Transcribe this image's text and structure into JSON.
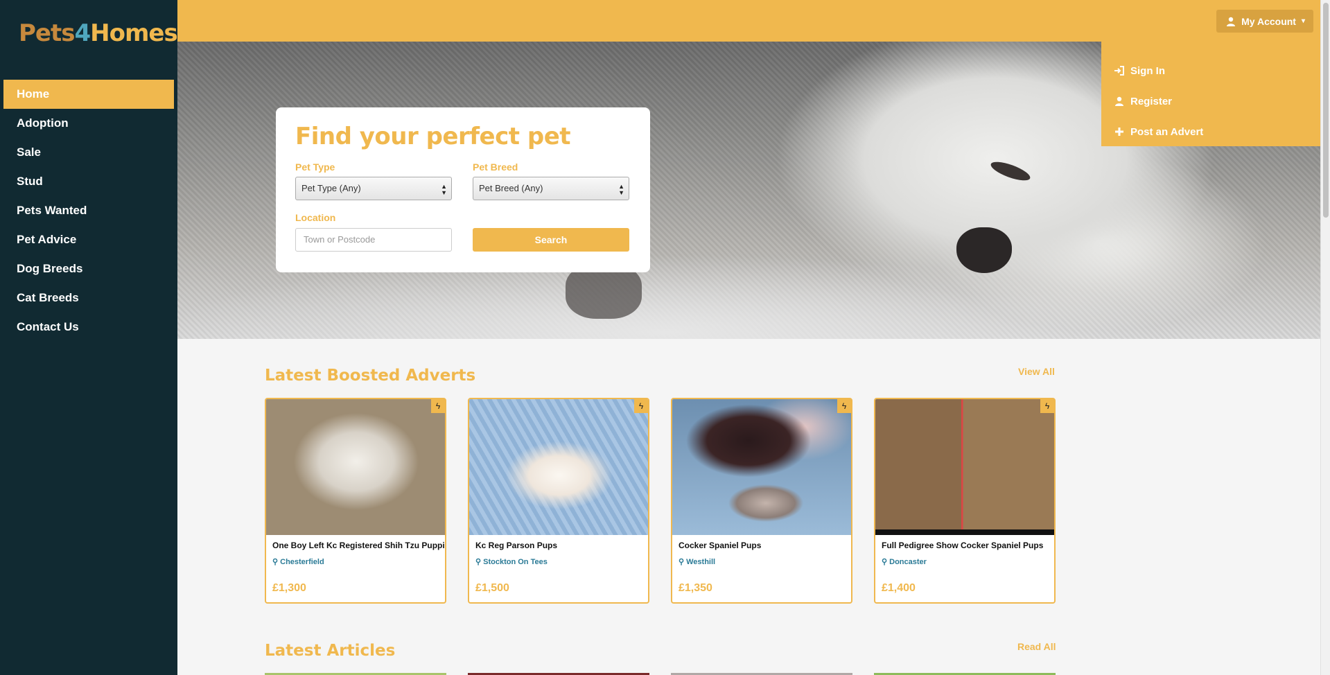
{
  "brand": {
    "part1": "Pets",
    "part2": "4",
    "part3": "Homes"
  },
  "nav": [
    {
      "label": "Home",
      "active": true
    },
    {
      "label": "Adoption"
    },
    {
      "label": "Sale"
    },
    {
      "label": "Stud"
    },
    {
      "label": "Pets Wanted"
    },
    {
      "label": "Pet Advice"
    },
    {
      "label": "Dog Breeds"
    },
    {
      "label": "Cat Breeds"
    },
    {
      "label": "Contact Us"
    }
  ],
  "header": {
    "account_label": "My Account",
    "account_icon": "user-icon"
  },
  "account_menu": [
    {
      "label": "Sign In",
      "icon": "sign-in-icon"
    },
    {
      "label": "Register",
      "icon": "user-icon"
    },
    {
      "label": "Post an Advert",
      "icon": "plus-icon"
    }
  ],
  "search": {
    "title": "Find your perfect pet",
    "pet_type_label": "Pet Type",
    "pet_type_value": "Pet Type (Any)",
    "pet_breed_label": "Pet Breed",
    "pet_breed_value": "Pet Breed (Any)",
    "location_label": "Location",
    "location_placeholder": "Town or Postcode",
    "button": "Search"
  },
  "boosted": {
    "title": "Latest Boosted Adverts",
    "link": "View All",
    "cards": [
      {
        "title": "One Boy Left Kc Registered Shih Tzu Puppies",
        "location": "Chesterfield",
        "price": "£1,300"
      },
      {
        "title": "Kc Reg Parson Pups",
        "location": "Stockton On Tees",
        "price": "£1,500"
      },
      {
        "title": "Cocker Spaniel Pups",
        "location": "Westhill",
        "price": "£1,350"
      },
      {
        "title": "Full Pedigree Show Cocker Spaniel Pups",
        "location": "Doncaster",
        "price": "£1,400"
      }
    ]
  },
  "articles": {
    "title": "Latest Articles",
    "link": "Read All"
  },
  "colors": {
    "accent": "#f0b84e",
    "sidebar": "#112a32",
    "location": "#2a7a96"
  }
}
